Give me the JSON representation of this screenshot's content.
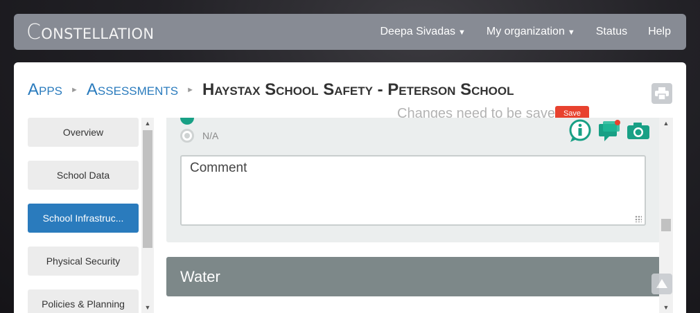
{
  "navbar": {
    "logo_text": "ONSTELLATION",
    "logo_first": "C",
    "items": [
      {
        "label": "Deepa Sivadas",
        "has_caret": true
      },
      {
        "label": "My organization",
        "has_caret": true
      },
      {
        "label": "Status",
        "has_caret": false
      },
      {
        "label": "Help",
        "has_caret": false
      }
    ]
  },
  "breadcrumb": {
    "apps": "Apps",
    "assessments": "Assessments",
    "current": "Haystax School Safety - Peterson School"
  },
  "save": {
    "hint": "Changes need to be saved",
    "button_label": "Save"
  },
  "sidebar": {
    "items": [
      {
        "label": "Overview",
        "active": false
      },
      {
        "label": "School Data",
        "active": false
      },
      {
        "label": "School Infrastruc...",
        "active": true
      },
      {
        "label": "Physical Security",
        "active": false
      },
      {
        "label": "Policies & Planning",
        "active": false
      }
    ]
  },
  "question": {
    "option_label": "N/A",
    "comment_placeholder": "Comment",
    "icons": [
      "info-icon",
      "comments-icon",
      "camera-icon"
    ]
  },
  "sections": {
    "next_title": "Water"
  },
  "colors": {
    "accent": "#2a7bbd",
    "teal": "#18a085",
    "save_red": "#e8422f",
    "section_gray": "#7d8889"
  }
}
